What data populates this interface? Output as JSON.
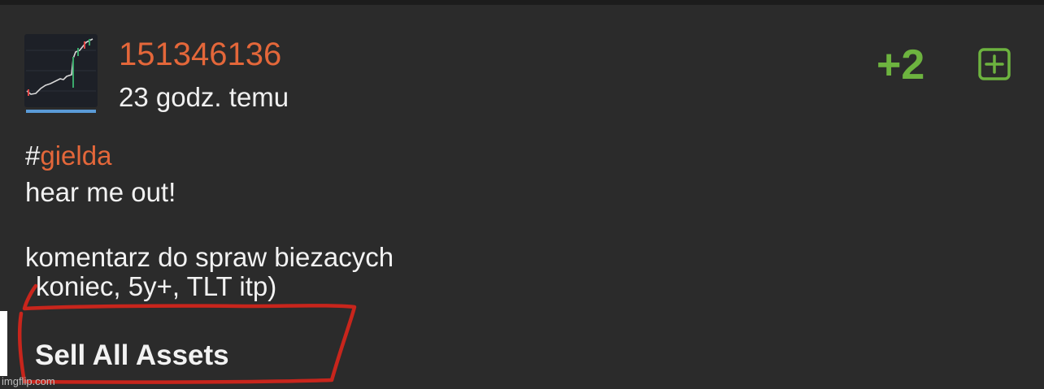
{
  "post": {
    "author": "151346136",
    "time_ago": "23 godz. temu",
    "vote_count": "+2",
    "plus_icon": "plus-square-icon",
    "avatar_icon": "stock-chart-thumbnail",
    "tag_prefix": "#",
    "tag_name": "gielda",
    "lines": [
      "hear me out!",
      "komentarz do spraw biezacych"
    ],
    "cut_line": "koniec, 5y+,  TLT  itp)",
    "edited_button": "Sell All Assets"
  },
  "watermark": "imgflip.com",
  "colors": {
    "background": "#2b2b2b",
    "accent_orange": "#e4673a",
    "vote_green": "#6db33f",
    "scribble_red": "#c8251c",
    "avatar_underline": "#5a9bd8"
  }
}
